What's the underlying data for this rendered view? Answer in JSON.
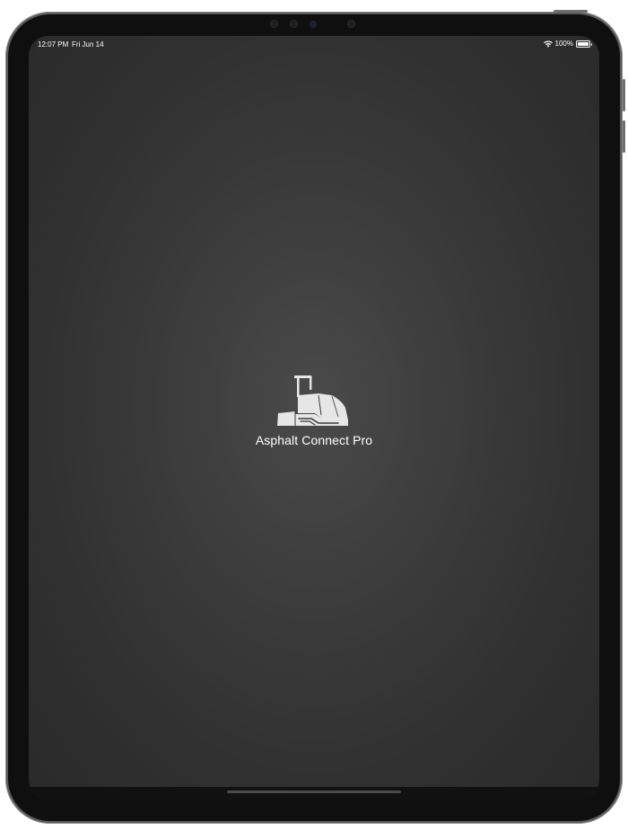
{
  "status_bar": {
    "time": "12:07 PM",
    "date": "Fri Jun 14",
    "battery": "100%",
    "wifi_icon": "wifi-icon",
    "battery_icon": "battery-icon"
  },
  "splash": {
    "app_name": "Asphalt Connect Pro",
    "logo_icon": "asphalt-paver-icon"
  },
  "colors": {
    "screen_center": "#4a4a4a",
    "screen_edge": "#2a2a2a",
    "text": "#ffffff",
    "logo": "#e8e8e8"
  }
}
